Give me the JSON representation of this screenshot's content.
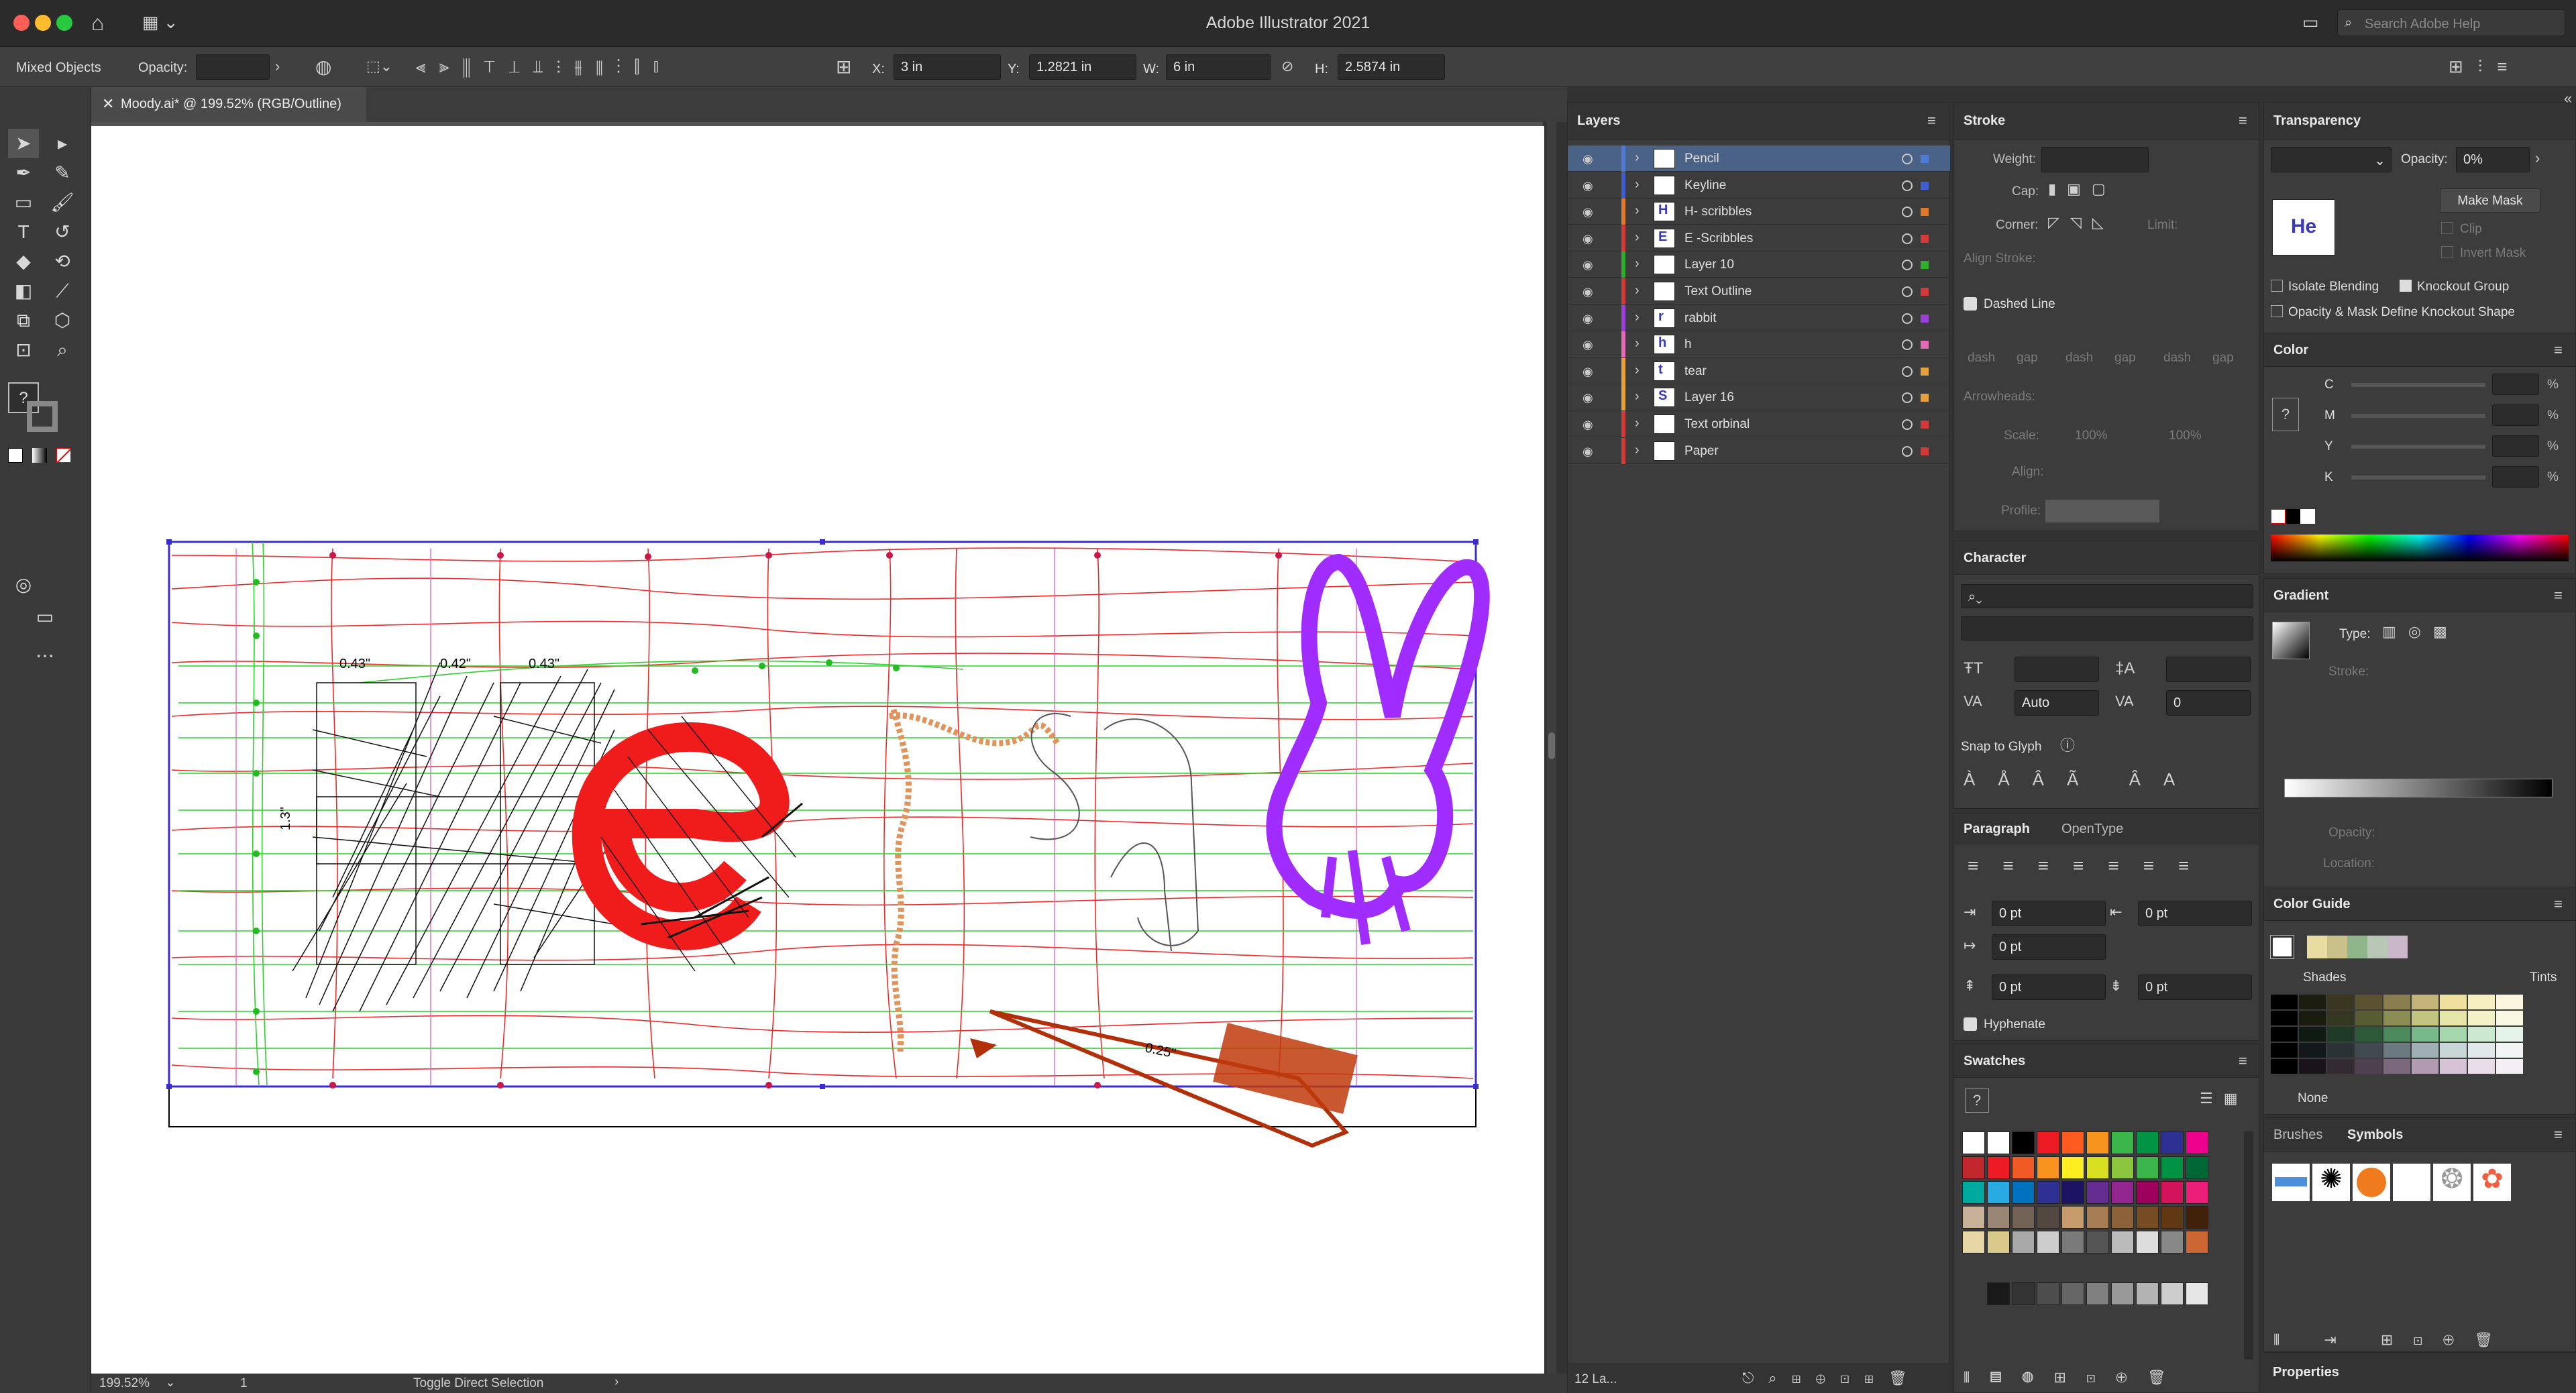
{
  "app": {
    "title": "Adobe Illustrator 2021",
    "search_placeholder": "Search Adobe Help"
  },
  "control_bar": {
    "selection": "Mixed Objects",
    "opacity_label": "Opacity:",
    "x_label": "X:",
    "x_value": "3 in",
    "y_label": "Y:",
    "y_value": "1.2821 in",
    "w_label": "W:",
    "w_value": "6 in",
    "h_label": "H:",
    "h_value": "2.5874 in"
  },
  "document": {
    "tab_title": "Moody.ai* @ 199.52% (RGB/Outline)"
  },
  "artwork": {
    "dim1": "0.43\"",
    "dim2": "0.42\"",
    "dim3": "0.43\"",
    "dim4": "1.3\"",
    "dim5": "0.25\""
  },
  "status": {
    "zoom": "199.52%",
    "artboard": "1",
    "tool": "Toggle Direct Selection"
  },
  "layers": {
    "title": "Layers",
    "count": "12 La...",
    "items": [
      {
        "name": "Pencil",
        "color": "#4f7bd6",
        "thumb": "",
        "selected": true
      },
      {
        "name": "Keyline",
        "color": "#3f5fd0",
        "thumb": ""
      },
      {
        "name": "H- scribbles",
        "color": "#e07a2a",
        "thumb": "H"
      },
      {
        "name": "E -Scribbles",
        "color": "#d43a3a",
        "thumb": "E"
      },
      {
        "name": "Layer 10",
        "color": "#2fae2f",
        "thumb": ""
      },
      {
        "name": "Text Outline",
        "color": "#d43a3a",
        "thumb": ""
      },
      {
        "name": "rabbit",
        "color": "#9b3fd9",
        "thumb": "r"
      },
      {
        "name": "h",
        "color": "#e46ab8",
        "thumb": "h"
      },
      {
        "name": "tear",
        "color": "#e6a13a",
        "thumb": "t"
      },
      {
        "name": "Layer 16",
        "color": "#e6a13a",
        "thumb": "S"
      },
      {
        "name": "Text orbinal",
        "color": "#d43a3a",
        "thumb": ""
      },
      {
        "name": "Paper",
        "color": "#d43a3a",
        "thumb": ""
      }
    ]
  },
  "stroke": {
    "title": "Stroke",
    "weight": "Weight:",
    "cap": "Cap:",
    "corner": "Corner:",
    "limit": "Limit:",
    "align_stroke": "Align Stroke:",
    "dashed_line": "Dashed Line",
    "dash_labels": [
      "dash",
      "gap",
      "dash",
      "gap",
      "dash",
      "gap"
    ],
    "arrowheads": "Arrowheads:",
    "scale": "Scale:",
    "scale_val1": "100%",
    "scale_val2": "100%",
    "align": "Align:",
    "profile": "Profile:"
  },
  "character": {
    "title": "Character",
    "leading": "Auto",
    "tracking": "0",
    "snap_to_glyph": "Snap to Glyph"
  },
  "paragraph": {
    "title": "Paragraph",
    "tab2": "OpenType",
    "indent_left": "0 pt",
    "indent_right": "0 pt",
    "first_line": "0 pt",
    "space_before": "0 pt",
    "space_after": "0 pt",
    "hyphenate": "Hyphenate"
  },
  "swatches": {
    "title": "Swatches",
    "colors": [
      "#ffffff",
      "#ffffff",
      "#000000",
      "#ed1c24",
      "#ff5a1f",
      "#f7941d",
      "#39b54a",
      "#009444",
      "#2e3192",
      "#ec008c",
      "#c1272d",
      "#ed1c24",
      "#f15a24",
      "#f7931e",
      "#fcee21",
      "#d9e021",
      "#8cc63f",
      "#39b54a",
      "#009245",
      "#006837",
      "#00a99d",
      "#29abe2",
      "#0071bc",
      "#2e3192",
      "#1b1464",
      "#662d91",
      "#93278f",
      "#9e005d",
      "#d4145a",
      "#ed1e79",
      "#c7b299",
      "#998675",
      "#736357",
      "#534741",
      "#c69c6d",
      "#a67c52",
      "#8c6239",
      "#754c24",
      "#603813",
      "#42210b",
      "#e6d6a6",
      "#d9c98a",
      "#a8a8a8",
      "#cccccc",
      "#7a7a7a",
      "#555555",
      "#bbbbbb",
      "#dddddd",
      "#888888",
      "#cc6633"
    ],
    "grays": [
      "#1a1a1a",
      "#333333",
      "#4d4d4d",
      "#666666",
      "#808080",
      "#999999",
      "#b3b3b3",
      "#cccccc",
      "#e6e6e6"
    ]
  },
  "transparency": {
    "title": "Transparency",
    "opacity_label": "Opacity:",
    "opacity": "0%",
    "make_mask": "Make Mask",
    "clip": "Clip",
    "invert_mask": "Invert Mask",
    "isolate_blending": "Isolate Blending",
    "knockout_group": "Knockout Group",
    "opacity_mask": "Opacity & Mask Define Knockout Shape",
    "thumb_text": "He"
  },
  "color": {
    "title": "Color",
    "channels": [
      "C",
      "M",
      "Y",
      "K"
    ],
    "pct": "%"
  },
  "gradient": {
    "title": "Gradient",
    "type": "Type:",
    "stroke": "Stroke:",
    "opacity": "Opacity:",
    "location": "Location:"
  },
  "color_guide": {
    "title": "Color Guide",
    "shades": "Shades",
    "tints": "Tints",
    "none": "None",
    "guide_colors": [
      "#e8dca0",
      "#c9c08a",
      "#8fb58a",
      "#b8c7b6",
      "#c8b8c8"
    ]
  },
  "brushes": {
    "tab1": "Brushes",
    "tab2": "Symbols"
  },
  "properties": {
    "title": "Properties"
  }
}
